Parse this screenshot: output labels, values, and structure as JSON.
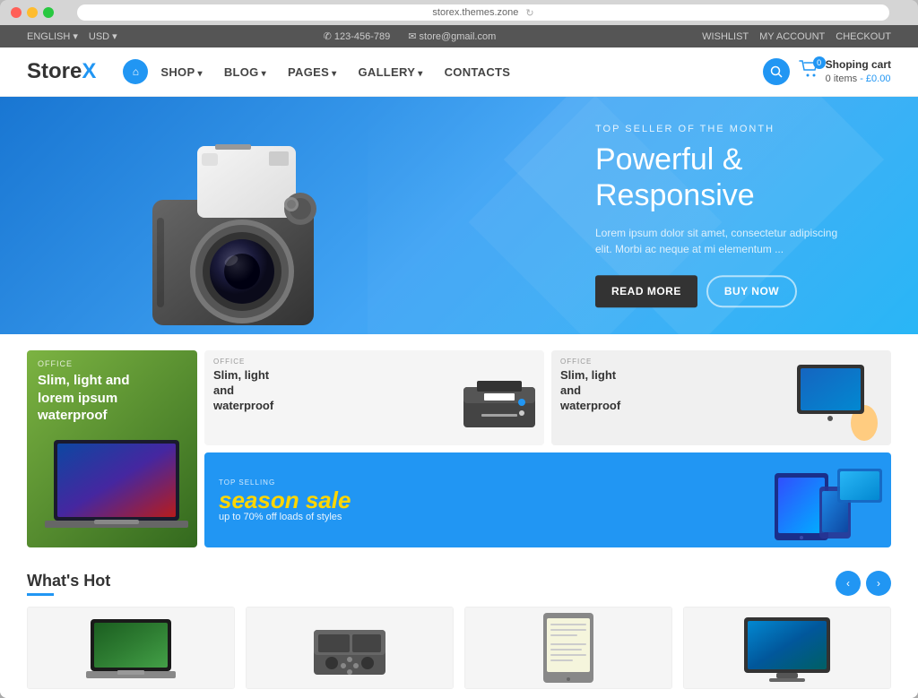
{
  "browser": {
    "url": "storex.themes.zone",
    "refresh_icon": "↻"
  },
  "topbar": {
    "language": "ENGLISH",
    "currency": "USD",
    "phone": "✆ 123-456-789",
    "email": "✉ store@gmail.com",
    "wishlist": "WISHLIST",
    "account": "MY ACCOUNT",
    "checkout": "CHECKOUT"
  },
  "nav": {
    "logo_text": "Store",
    "logo_x": "X",
    "home_icon": "⌂",
    "links": [
      {
        "label": "SHOP",
        "dropdown": true
      },
      {
        "label": "BLOG",
        "dropdown": true
      },
      {
        "label": "PAGES",
        "dropdown": true
      },
      {
        "label": "GALLERY",
        "dropdown": true
      },
      {
        "label": "CONTACTS",
        "dropdown": false
      }
    ],
    "search_icon": "🔍",
    "cart_icon": "🛒",
    "cart_label": "Shoping cart",
    "cart_items": "0 items",
    "cart_amount": "- £0.00"
  },
  "hero": {
    "subtitle": "TOP SELLER OF THE MONTH",
    "title": "Powerful & Responsive",
    "description": "Lorem ipsum dolor sit amet, consectetur adipiscing elit. Morbi ac neque at mi elementum ...",
    "btn_readmore": "READ MORE",
    "btn_buynow": "BUY NOW"
  },
  "promos": {
    "card1": {
      "label": "OFFICE",
      "text": "Slim, light and lorem ipsum waterproof"
    },
    "card2": {
      "label": "OFFICE",
      "text": "Slim, light and waterproof"
    },
    "card3": {
      "label": "OFFICE",
      "text": "Slim, light and waterproof"
    },
    "sale": {
      "label": "TOP SELLING",
      "title": "season sale",
      "subtitle": "up to 70% off loads of styles"
    }
  },
  "whats_hot": {
    "title": "What's Hot",
    "prev_icon": "‹",
    "next_icon": "›"
  },
  "products": [
    {
      "id": 1,
      "type": "macbook"
    },
    {
      "id": 2,
      "type": "console"
    },
    {
      "id": 3,
      "type": "kindle"
    },
    {
      "id": 4,
      "type": "tablet"
    }
  ]
}
